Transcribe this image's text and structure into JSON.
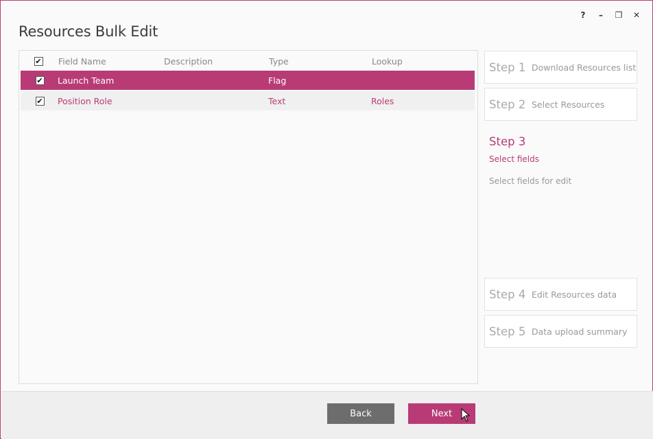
{
  "window": {
    "title": "Resources Bulk Edit",
    "controls": {
      "help": "?",
      "minimize": "–",
      "restore": "❐",
      "close": "✕"
    }
  },
  "grid": {
    "columns": {
      "field_name": "Field Name",
      "description": "Description",
      "type": "Type",
      "lookup": "Lookup"
    },
    "header_checked": true,
    "rows": [
      {
        "checked": true,
        "field_name": "Launch Team",
        "description": "",
        "type": "Flag",
        "lookup": ""
      },
      {
        "checked": true,
        "field_name": "Position Role",
        "description": "",
        "type": "Text",
        "lookup": "Roles"
      }
    ]
  },
  "steps": [
    {
      "num": "Step 1",
      "label": "Download Resources list"
    },
    {
      "num": "Step 2",
      "label": "Select Resources"
    },
    {
      "num": "Step 3",
      "label": "Select fields",
      "description": "Select fields for edit",
      "active": true
    },
    {
      "num": "Step 4",
      "label": "Edit Resources data"
    },
    {
      "num": "Step 5",
      "label": "Data upload summary"
    }
  ],
  "footer": {
    "back_label": "Back",
    "next_label": "Next"
  },
  "colors": {
    "accent": "#b83b76",
    "back_button": "#6d6d6d"
  }
}
